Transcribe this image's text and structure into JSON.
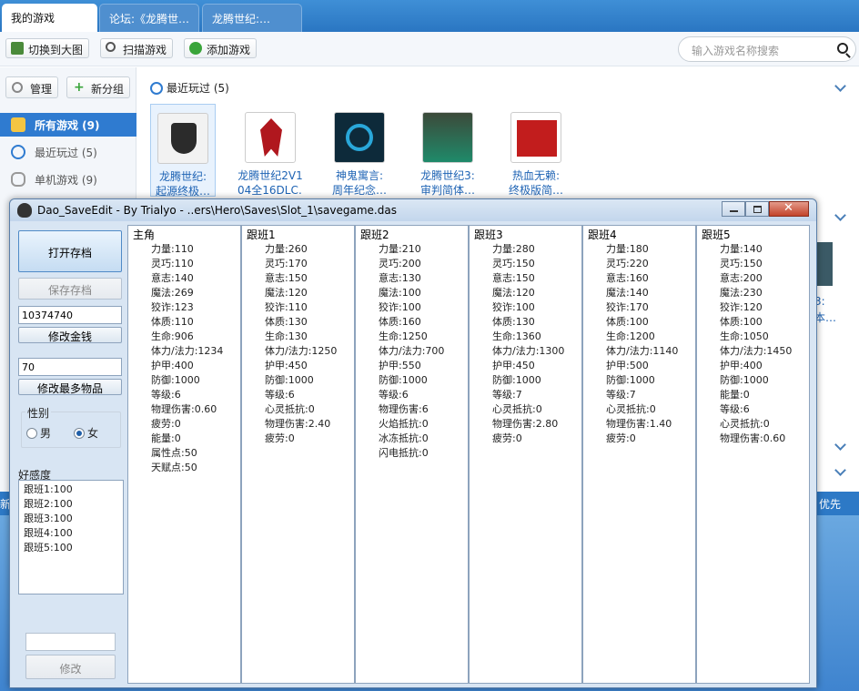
{
  "launcher": {
    "tabs": [
      "我的游戏",
      "论坛:《龙腾世…",
      "龙腾世纪:…"
    ],
    "toolbar": {
      "switch_label": "切换到大图",
      "scan_label": "扫描游戏",
      "add_label": "添加游戏",
      "search_placeholder": "输入游戏名称搜索"
    },
    "sidebar": {
      "manage_label": "管理",
      "new_group_label": "新分组",
      "items": [
        {
          "label": "所有游戏 (9)"
        },
        {
          "label": "最近玩过 (5)"
        },
        {
          "label": "单机游戏 (9)"
        }
      ]
    },
    "recent": {
      "heading": "最近玩过 (5)",
      "games": [
        {
          "title_line1": "龙腾世纪:",
          "title_line2": "起源终极…"
        },
        {
          "title_line1": "龙腾世纪2V1",
          "title_line2": "04全16DLC…"
        },
        {
          "title_line1": "神鬼寓言:",
          "title_line2": "周年纪念…"
        },
        {
          "title_line1": "龙腾世纪3:",
          "title_line2": "审判简体…"
        },
        {
          "title_line1": "热血无赖:",
          "title_line2": "终极版简…"
        }
      ],
      "partial_right_title": "3:",
      "partial_right_sub": "本…"
    },
    "status_right": "优先",
    "status_left": "新"
  },
  "saveedit": {
    "title": "Dao_SaveEdit - By Trialyo - ..ers\\Hero\\Saves\\Slot_1\\savegame.das",
    "open_label": "打开存档",
    "save_label": "保存存档",
    "money_value": "10374740",
    "modify_money_label": "修改金钱",
    "items_value": "70",
    "modify_items_label": "修改最多物品",
    "gender_label": "性别",
    "male_label": "男",
    "female_label": "女",
    "affinity_label": "好感度",
    "affinity": [
      "跟班1:100",
      "跟班2:100",
      "跟班3:100",
      "跟班4:100",
      "跟班5:100"
    ],
    "modify_label": "修改",
    "columns": [
      {
        "name": "主角",
        "rows": [
          "力量:110",
          "灵巧:110",
          "意志:140",
          "魔法:269",
          "狡诈:123",
          "体质:110",
          "生命:906",
          "体力/法力:1234",
          "护甲:400",
          "防御:1000",
          "等级:6",
          "物理伤害:0.60",
          "疲劳:0",
          "能量:0",
          "属性点:50",
          "天赋点:50"
        ]
      },
      {
        "name": "跟班1",
        "rows": [
          "力量:260",
          "灵巧:170",
          "意志:150",
          "魔法:120",
          "狡诈:110",
          "体质:130",
          "生命:130",
          "体力/法力:1250",
          "护甲:450",
          "防御:1000",
          "等级:6",
          "心灵抵抗:0",
          "物理伤害:2.40",
          "疲劳:0"
        ]
      },
      {
        "name": "跟班2",
        "rows": [
          "力量:210",
          "灵巧:200",
          "意志:130",
          "魔法:100",
          "狡诈:100",
          "体质:160",
          "生命:1250",
          "体力/法力:700",
          "护甲:550",
          "防御:1000",
          "等级:6",
          "物理伤害:6",
          "火焰抵抗:0",
          "冰冻抵抗:0",
          "闪电抵抗:0"
        ]
      },
      {
        "name": "跟班3",
        "rows": [
          "力量:280",
          "灵巧:150",
          "意志:150",
          "魔法:120",
          "狡诈:100",
          "体质:130",
          "生命:1360",
          "体力/法力:1300",
          "护甲:450",
          "防御:1000",
          "等级:7",
          "心灵抵抗:0",
          "物理伤害:2.80",
          "疲劳:0"
        ]
      },
      {
        "name": "跟班4",
        "rows": [
          "力量:180",
          "灵巧:220",
          "意志:160",
          "魔法:140",
          "狡诈:170",
          "体质:100",
          "生命:1200",
          "体力/法力:1140",
          "护甲:500",
          "防御:1000",
          "等级:7",
          "心灵抵抗:0",
          "物理伤害:1.40",
          "疲劳:0"
        ]
      },
      {
        "name": "跟班5",
        "rows": [
          "力量:140",
          "灵巧:150",
          "意志:200",
          "魔法:230",
          "狡诈:120",
          "体质:100",
          "生命:1050",
          "体力/法力:1450",
          "护甲:400",
          "防御:1000",
          "能量:0",
          "等级:6",
          "心灵抵抗:0",
          "物理伤害:0.60"
        ]
      }
    ]
  }
}
